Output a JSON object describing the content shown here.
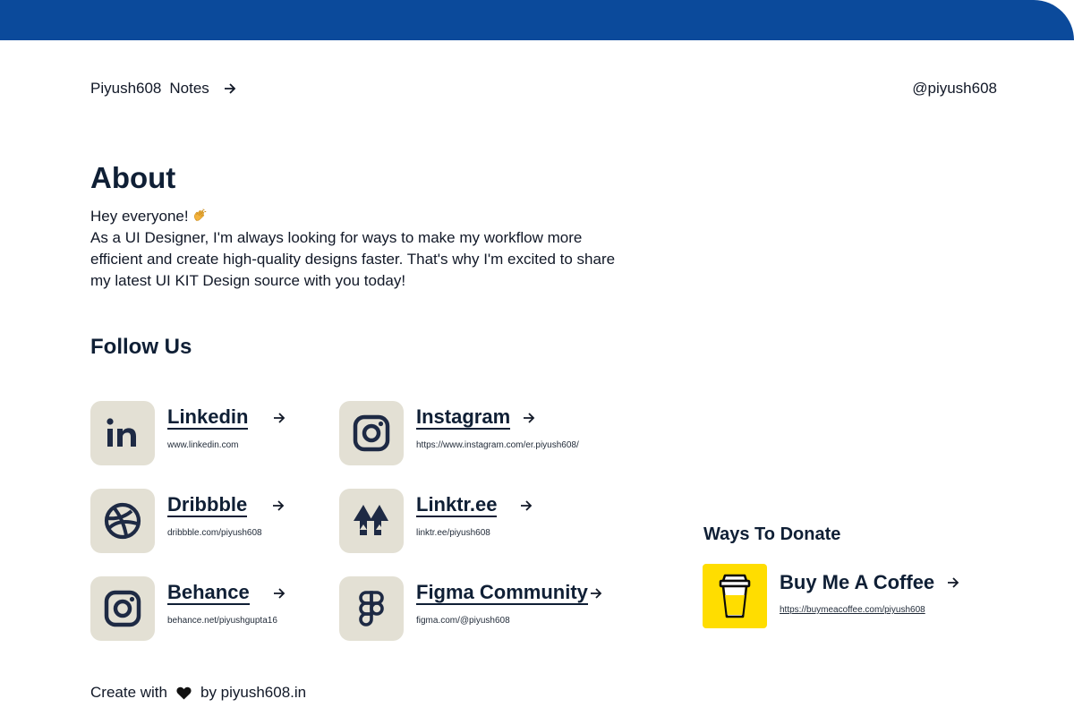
{
  "header": {
    "brand": "Piyush608",
    "notes_label": "Notes",
    "handle": "@piyush608"
  },
  "about": {
    "title": "About",
    "greeting": "Hey everyone!",
    "body": "As a UI Designer, I'm always looking for ways to make my workflow more efficient and create high-quality designs faster. That's why I'm excited to share my latest UI KIT Design source with you today!"
  },
  "follow": {
    "title": "Follow Us",
    "links": [
      {
        "name": "Linkedin",
        "url": "www.linkedin.com",
        "icon": "linkedin-icon"
      },
      {
        "name": "Instagram",
        "url": "https://www.instagram.com/er.piyush608/",
        "icon": "instagram-icon"
      },
      {
        "name": "Dribbble",
        "url": "dribbble.com/piyush608",
        "icon": "dribbble-icon"
      },
      {
        "name": "Linktr.ee",
        "url": "linktr.ee/piyush608",
        "icon": "linktree-icon"
      },
      {
        "name": "Behance",
        "url": "behance.net/piyushgupta16",
        "icon": "behance-icon"
      },
      {
        "name": "Figma Community",
        "url": "figma.com/@piyush608",
        "icon": "figma-icon"
      }
    ]
  },
  "donate": {
    "title": "Ways To Donate",
    "name": "Buy Me A Coffee",
    "url": "https://buymeacoffee.com/piyush608",
    "icon": "coffee-cup-icon"
  },
  "footer": {
    "prefix": "Create with",
    "suffix": "by piyush608.in",
    "icon": "heart-icon"
  },
  "colors": {
    "top_bar": "#0b4a9b",
    "tile_bg": "#e3e0d4",
    "icon_dark": "#1e2a44",
    "coffee_bg": "#ffdd00",
    "text_dark": "#0f1f35"
  }
}
